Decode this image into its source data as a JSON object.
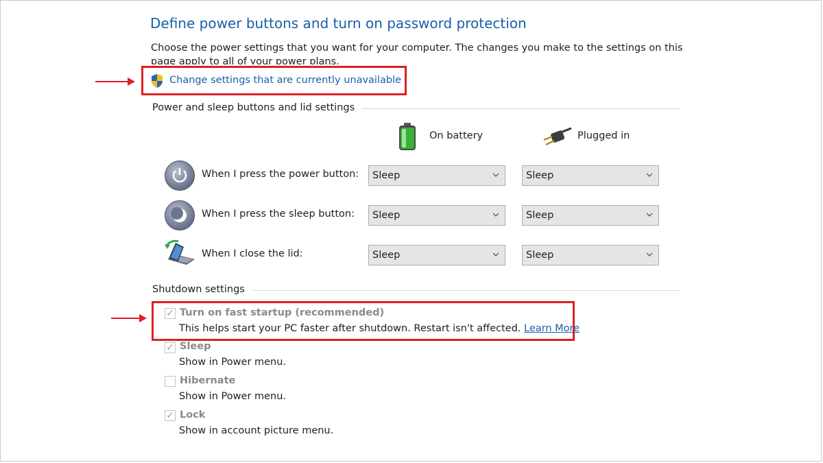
{
  "page": {
    "title": "Define power buttons and turn on password protection",
    "description": "Choose the power settings that you want for your computer. The changes you make to the settings on this page apply to all of your power plans.",
    "change_settings_link": "Change settings that are currently unavailable"
  },
  "power_section": {
    "label": "Power and sleep buttons and lid settings",
    "columns": {
      "battery": "On battery",
      "plugged": "Plugged in"
    },
    "rows": [
      {
        "label": "When I press the power button:",
        "battery": "Sleep",
        "plugged": "Sleep",
        "icon": "power-button-icon"
      },
      {
        "label": "When I press the sleep button:",
        "battery": "Sleep",
        "plugged": "Sleep",
        "icon": "sleep-button-icon"
      },
      {
        "label": "When I close the lid:",
        "battery": "Sleep",
        "plugged": "Sleep",
        "icon": "laptop-lid-icon"
      }
    ]
  },
  "shutdown_section": {
    "label": "Shutdown settings",
    "fast_startup": {
      "title": "Turn on fast startup (recommended)",
      "description": "This helps start your PC faster after shutdown. Restart isn't affected.",
      "learn_more": "Learn More",
      "checked": true
    },
    "options": [
      {
        "title": "Sleep",
        "description": "Show in Power menu.",
        "checked": true
      },
      {
        "title": "Hibernate",
        "description": "Show in Power menu.",
        "checked": false
      },
      {
        "title": "Lock",
        "description": "Show in account picture menu.",
        "checked": true
      }
    ]
  },
  "colors": {
    "title_blue": "#1a5ea8",
    "highlight_red": "#e01e25",
    "disabled_text": "#8a8a8a"
  }
}
